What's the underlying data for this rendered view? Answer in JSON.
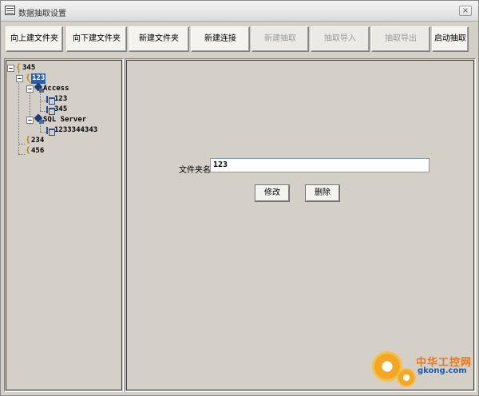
{
  "window": {
    "title": "数据抽取设置",
    "close_label": "×"
  },
  "toolbar": {
    "buttons": [
      {
        "label": "向上建文件夹",
        "enabled": true
      },
      {
        "label": "向下建文件夹",
        "enabled": true
      },
      {
        "label": "新建文件夹",
        "enabled": true
      },
      {
        "label": "新建连接",
        "enabled": true
      },
      {
        "label": "新建抽取",
        "enabled": false
      },
      {
        "label": "抽取导入",
        "enabled": false
      },
      {
        "label": "抽取导出",
        "enabled": false
      },
      {
        "label": "启动抽取",
        "enabled": true
      }
    ]
  },
  "tree": {
    "nodes": [
      {
        "label": "345",
        "icon": "folder-icon",
        "expander": "−"
      },
      {
        "label": "123",
        "icon": "folder-icon",
        "expander": "−",
        "selected": true
      },
      {
        "label": "Access",
        "icon": "database-icon",
        "expander": "−"
      },
      {
        "label": "123",
        "icon": "table-icon"
      },
      {
        "label": "345",
        "icon": "table-icon"
      },
      {
        "label": "SQL Server",
        "icon": "database-icon",
        "expander": "−"
      },
      {
        "label": "1233344343",
        "icon": "table-icon"
      },
      {
        "label": "234",
        "icon": "folder-icon"
      },
      {
        "label": "456",
        "icon": "folder-icon"
      }
    ]
  },
  "form": {
    "folder_name_label": "文件夹名:",
    "folder_name_value": "123",
    "modify_label": "修改",
    "delete_label": "删除"
  },
  "watermark": {
    "title": "中华工控网",
    "url": "gkong.com"
  },
  "colors": {
    "window_bg": "#d4d0c8",
    "selection": "#2d5fa6",
    "disabled_text": "#9a9a9a",
    "watermark_orange": "#e8761e"
  }
}
